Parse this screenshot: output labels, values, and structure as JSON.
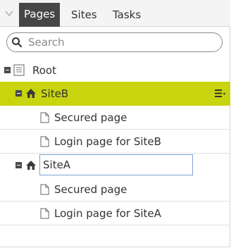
{
  "tabs": [
    {
      "label": "Pages",
      "active": true
    },
    {
      "label": "Sites",
      "active": false
    },
    {
      "label": "Tasks",
      "active": false
    }
  ],
  "search": {
    "placeholder": "Search",
    "value": ""
  },
  "tree": {
    "root": {
      "label": "Root"
    },
    "siteB": {
      "label": "SiteB",
      "selected": true
    },
    "siteB_children": [
      {
        "label": "Secured page"
      },
      {
        "label": "Login page for SiteB"
      }
    ],
    "siteA": {
      "label": "SiteA",
      "editing": true
    },
    "siteA_children": [
      {
        "label": "Secured page"
      },
      {
        "label": "Login page for SiteA"
      }
    ]
  },
  "colors": {
    "selected_row": "#c8d40e",
    "active_tab": "#464646",
    "rename_border": "#7fa2d8"
  },
  "icons": {
    "collapse": "chevron-down-icon",
    "search": "search-icon",
    "root_page": "document-list-icon",
    "site": "home-icon",
    "page": "page-icon",
    "row_menu": "hamburger-menu-icon"
  }
}
